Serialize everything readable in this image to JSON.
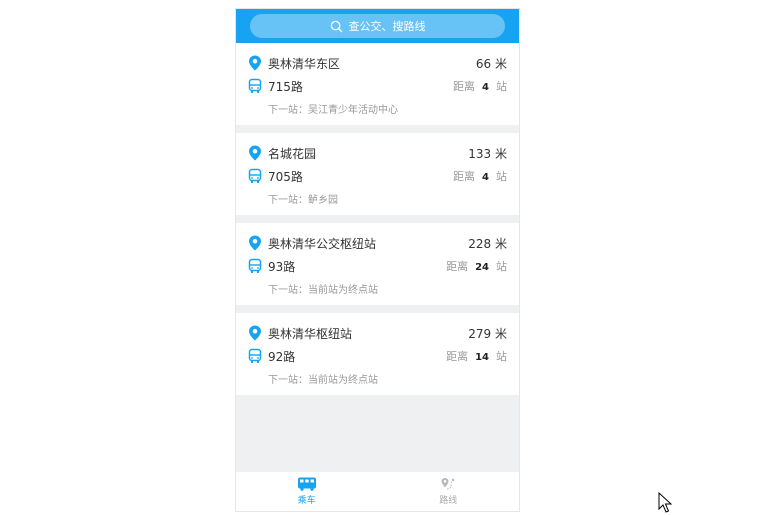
{
  "search": {
    "placeholder": "查公交、搜路线"
  },
  "stations": [
    {
      "name": "奥林清华东区",
      "distance": "66 米",
      "route": "715路",
      "far_prefix": "距离",
      "stops": "4",
      "far_suffix": "站",
      "next": "下一站：吴江青少年活动中心"
    },
    {
      "name": "名城花园",
      "distance": "133 米",
      "route": "705路",
      "far_prefix": "距离",
      "stops": "4",
      "far_suffix": "站",
      "next": "下一站：鲈乡园"
    },
    {
      "name": "奥林清华公交枢纽站",
      "distance": "228 米",
      "route": "93路",
      "far_prefix": "距离",
      "stops": "24",
      "far_suffix": "站",
      "next": "下一站：当前站为终点站"
    },
    {
      "name": "奥林清华枢纽站",
      "distance": "279 米",
      "route": "92路",
      "far_prefix": "距离",
      "stops": "14",
      "far_suffix": "站",
      "next": "下一站：当前站为终点站"
    }
  ],
  "tabs": [
    {
      "label": "乘车",
      "icon": "bus-icon",
      "active": true
    },
    {
      "label": "路线",
      "icon": "route-icon",
      "active": false
    }
  ],
  "colors": {
    "accent": "#16a3f2",
    "background": "#eff0f2"
  }
}
